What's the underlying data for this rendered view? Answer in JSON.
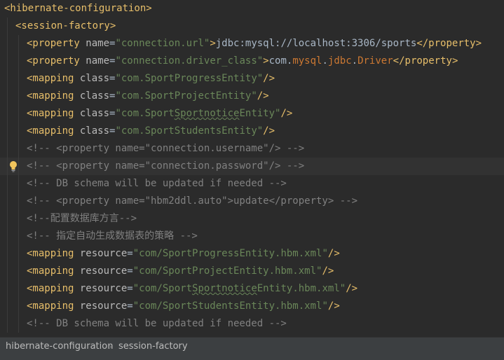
{
  "editor": {
    "lines": [
      {
        "indent": 0,
        "tokens": [
          [
            "tag",
            "<hibernate-configuration>"
          ]
        ]
      },
      {
        "indent": 1,
        "tokens": [
          [
            "tag",
            "<session-factory>"
          ]
        ]
      },
      {
        "indent": 2,
        "tokens": [
          [
            "tag",
            "<property "
          ],
          [
            "attr",
            "name"
          ],
          [
            "text",
            "="
          ],
          [
            "str",
            "\"connection.url\""
          ],
          [
            "tag",
            ">"
          ],
          [
            "text",
            "jdbc:mysql://localhost:3306/sports"
          ],
          [
            "tag",
            "</property>"
          ]
        ]
      },
      {
        "indent": 2,
        "tokens": [
          [
            "tag",
            "<property "
          ],
          [
            "attr",
            "name"
          ],
          [
            "text",
            "="
          ],
          [
            "str",
            "\"connection.driver_class\""
          ],
          [
            "tag",
            ">"
          ],
          [
            "text",
            "com."
          ],
          [
            "red",
            "mysql"
          ],
          [
            "text",
            "."
          ],
          [
            "red",
            "jdbc"
          ],
          [
            "text",
            "."
          ],
          [
            "red",
            "Driver"
          ],
          [
            "tag",
            "</property>"
          ]
        ]
      },
      {
        "indent": 2,
        "tokens": [
          [
            "tag",
            "<mapping "
          ],
          [
            "attr",
            "class"
          ],
          [
            "text",
            "="
          ],
          [
            "str",
            "\"com.SportProgressEntity\""
          ],
          [
            "tag",
            "/>"
          ]
        ]
      },
      {
        "indent": 2,
        "tokens": [
          [
            "tag",
            "<mapping "
          ],
          [
            "attr",
            "class"
          ],
          [
            "text",
            "="
          ],
          [
            "str",
            "\"com.SportProjectEntity\""
          ],
          [
            "tag",
            "/>"
          ]
        ]
      },
      {
        "indent": 2,
        "tokens": [
          [
            "tag",
            "<mapping "
          ],
          [
            "attr",
            "class"
          ],
          [
            "text",
            "="
          ],
          [
            "str",
            "\"com.Sport"
          ],
          [
            "strtypo",
            "Sportnotice"
          ],
          [
            "str",
            "Entity\""
          ],
          [
            "tag",
            "/>"
          ]
        ]
      },
      {
        "indent": 2,
        "tokens": [
          [
            "tag",
            "<mapping "
          ],
          [
            "attr",
            "class"
          ],
          [
            "text",
            "="
          ],
          [
            "str",
            "\"com.SportStudentsEntity\""
          ],
          [
            "tag",
            "/>"
          ]
        ]
      },
      {
        "indent": 2,
        "tokens": [
          [
            "comment",
            "<!-- <property name=\"connection.username\"/> -->"
          ]
        ]
      },
      {
        "indent": 2,
        "current": true,
        "bulb": true,
        "tokens": [
          [
            "comment",
            "<!-- <property name=\"connection.password\"/> -->"
          ]
        ]
      },
      {
        "indent": 2,
        "tokens": [
          [
            "comment",
            "<!-- DB schema will be updated if needed -->"
          ]
        ]
      },
      {
        "indent": 2,
        "tokens": [
          [
            "comment",
            "<!-- <property name=\"hbm2ddl.auto\">update</property> -->"
          ]
        ]
      },
      {
        "indent": 2,
        "tokens": [
          [
            "comment",
            "<!--配置数据库方言-->"
          ]
        ]
      },
      {
        "indent": 2,
        "tokens": [
          [
            "comment",
            "<!-- 指定自动生成数据表的策略 -->"
          ]
        ]
      },
      {
        "indent": 2,
        "tokens": [
          [
            "tag",
            "<mapping "
          ],
          [
            "attr",
            "resource"
          ],
          [
            "text",
            "="
          ],
          [
            "str",
            "\"com/SportProgressEntity.hbm.xml\""
          ],
          [
            "tag",
            "/>"
          ]
        ]
      },
      {
        "indent": 2,
        "tokens": [
          [
            "tag",
            "<mapping "
          ],
          [
            "attr",
            "resource"
          ],
          [
            "text",
            "="
          ],
          [
            "str",
            "\"com/SportProjectEntity.hbm.xml\""
          ],
          [
            "tag",
            "/>"
          ]
        ]
      },
      {
        "indent": 2,
        "tokens": [
          [
            "tag",
            "<mapping "
          ],
          [
            "attr",
            "resource"
          ],
          [
            "text",
            "="
          ],
          [
            "str",
            "\"com/Sport"
          ],
          [
            "strtypo",
            "Sportnotice"
          ],
          [
            "str",
            "Entity.hbm.xml\""
          ],
          [
            "tag",
            "/>"
          ]
        ]
      },
      {
        "indent": 2,
        "tokens": [
          [
            "tag",
            "<mapping "
          ],
          [
            "attr",
            "resource"
          ],
          [
            "text",
            "="
          ],
          [
            "str",
            "\"com/SportStudentsEntity.hbm.xml\""
          ],
          [
            "tag",
            "/>"
          ]
        ]
      },
      {
        "indent": 2,
        "tokens": [
          [
            "comment",
            "<!-- DB schema will be updated if needed -->"
          ]
        ]
      }
    ]
  },
  "breadcrumb": {
    "items": [
      "hibernate-configuration",
      "session-factory"
    ],
    "separator": "›"
  },
  "colors": {
    "background": "#2b2b2b",
    "tag": "#e8bf6a",
    "attribute": "#bababa",
    "string": "#6a8759",
    "comment": "#808080",
    "error": "#cc7832"
  },
  "icons": {
    "gutter": "lightbulb-icon"
  }
}
